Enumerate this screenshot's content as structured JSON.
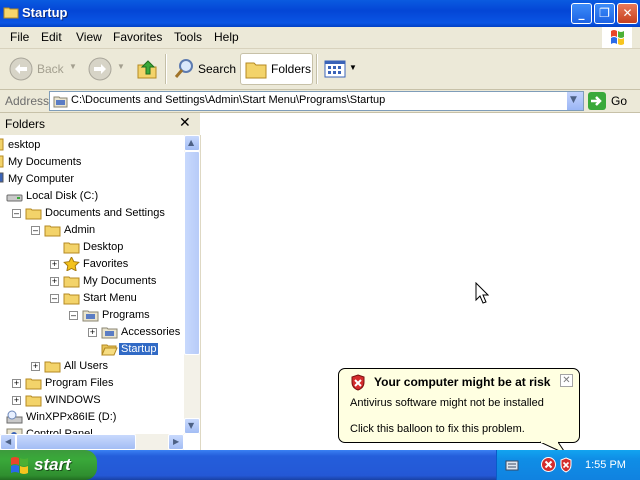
{
  "window": {
    "title": "Startup"
  },
  "menu": [
    "File",
    "Edit",
    "View",
    "Favorites",
    "Tools",
    "Help"
  ],
  "toolbar": {
    "back": "Back",
    "search": "Search",
    "folders": "Folders"
  },
  "address": {
    "label": "Address",
    "path": "C:\\Documents and Settings\\Admin\\Start Menu\\Programs\\Startup",
    "go": "Go"
  },
  "folders_pane": {
    "title": "Folders",
    "tree": [
      {
        "label": "esktop",
        "icon": "desktop-icon",
        "expander": ""
      },
      {
        "label": "My Documents",
        "icon": "my-documents-icon",
        "expander": ""
      },
      {
        "label": "My Computer",
        "icon": "my-computer-icon",
        "expander": ""
      },
      {
        "label": "Local Disk (C:)",
        "icon": "local-disk-icon",
        "expander": ""
      },
      {
        "label": "Documents and Settings",
        "icon": "folder-icon",
        "expander": "-"
      },
      {
        "label": "Admin",
        "icon": "folder-icon",
        "expander": "-"
      },
      {
        "label": "Desktop",
        "icon": "folder-icon",
        "expander": ""
      },
      {
        "label": "Favorites",
        "icon": "favorites-star-icon",
        "expander": "+"
      },
      {
        "label": "My Documents",
        "icon": "folder-icon",
        "expander": "+"
      },
      {
        "label": "Start Menu",
        "icon": "folder-icon",
        "expander": "-"
      },
      {
        "label": "Programs",
        "icon": "programs-folder-icon",
        "expander": "-"
      },
      {
        "label": "Accessories",
        "icon": "programs-folder-icon",
        "expander": "+"
      },
      {
        "label": "Startup",
        "icon": "open-folder-icon",
        "expander": ""
      },
      {
        "label": "All Users",
        "icon": "folder-icon",
        "expander": "+"
      },
      {
        "label": "Program Files",
        "icon": "folder-icon",
        "expander": "+"
      },
      {
        "label": "WINDOWS",
        "icon": "folder-icon",
        "expander": "+"
      },
      {
        "label": "WinXPPx86IE (D:)",
        "icon": "cd-drive-icon",
        "expander": ""
      },
      {
        "label": "Control Panel",
        "icon": "control-panel-icon",
        "expander": ""
      }
    ]
  },
  "balloon": {
    "title": "Your computer might be at risk",
    "line1": "Antivirus software might not be installed",
    "line2": "Click this balloon to fix this problem."
  },
  "taskbar": {
    "start": "start",
    "clock": "1:55 PM"
  },
  "colors": {
    "titlebar": "#0a55e4",
    "selection": "#316ac5",
    "taskbar": "#245edb",
    "start": "#3aa93a",
    "balloon": "#ffffe1"
  }
}
